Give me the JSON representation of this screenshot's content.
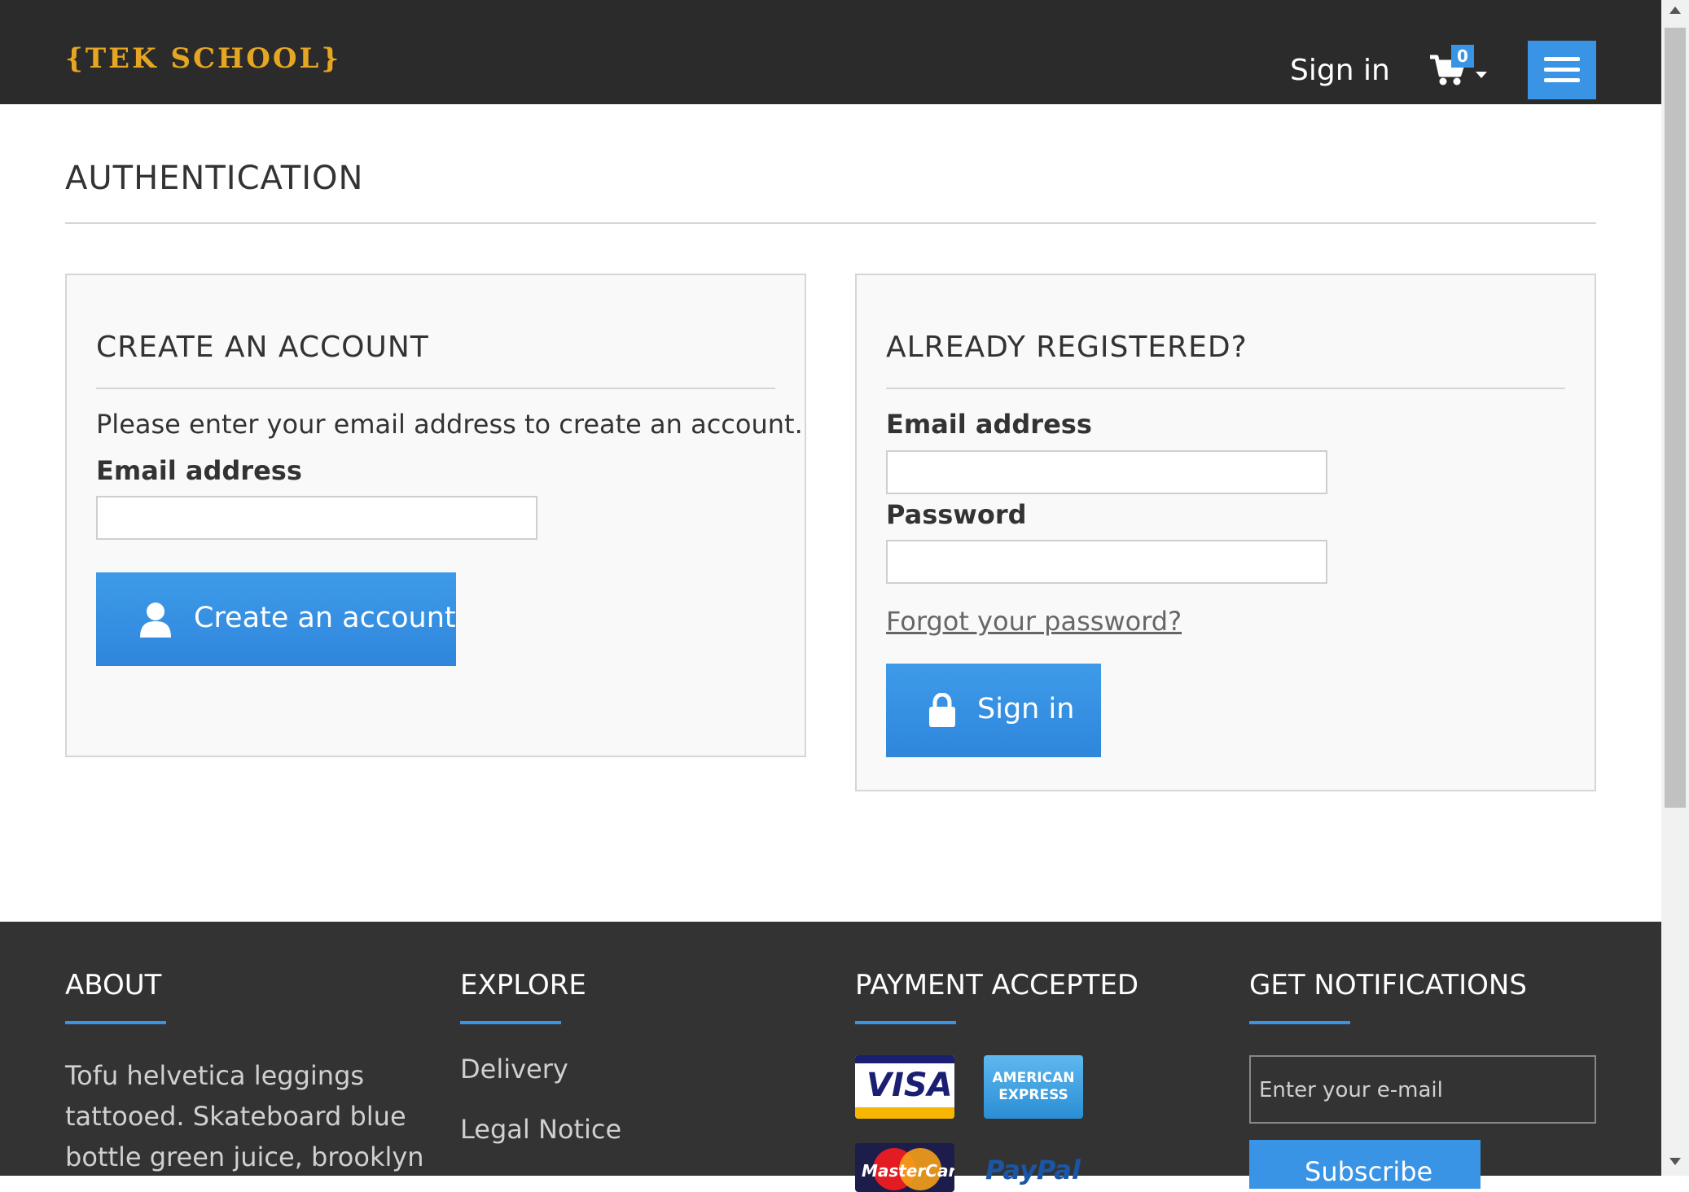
{
  "header": {
    "logo_text": "{TEK SCHOOL}",
    "signin_label": "Sign in",
    "cart_count": "0"
  },
  "page": {
    "title": "AUTHENTICATION"
  },
  "create_account": {
    "title": "CREATE AN ACCOUNT",
    "intro": "Please enter your email address to create an account.",
    "email_label": "Email address",
    "email_value": "",
    "button_label": "Create an account"
  },
  "login": {
    "title": "ALREADY REGISTERED?",
    "email_label": "Email address",
    "email_value": "",
    "password_label": "Password",
    "password_value": "",
    "forgot_label": "Forgot your password?",
    "button_label": "Sign in"
  },
  "footer": {
    "about_title": "ABOUT",
    "about_lines": [
      "Tofu helvetica leggings",
      "tattooed. Skateboard blue",
      "bottle green juice, brooklyn"
    ],
    "explore_title": "EXPLORE",
    "explore_links": [
      "Delivery",
      "Legal Notice"
    ],
    "payment_title": "PAYMENT ACCEPTED",
    "payment_logos": [
      "VISA",
      "AMERICAN EXPRESS",
      "MasterCard",
      "PayPal"
    ],
    "notify_title": "GET NOTIFICATIONS",
    "notify_placeholder": "Enter your e-mail",
    "subscribe_label": "Subscribe"
  },
  "colors": {
    "accent": "#3a94e6",
    "header_bg": "#2b2b2b",
    "footer_bg": "#333333",
    "logo": "#e6a621"
  },
  "icons": [
    "cart-icon",
    "menu-icon",
    "user-icon",
    "lock-icon"
  ]
}
